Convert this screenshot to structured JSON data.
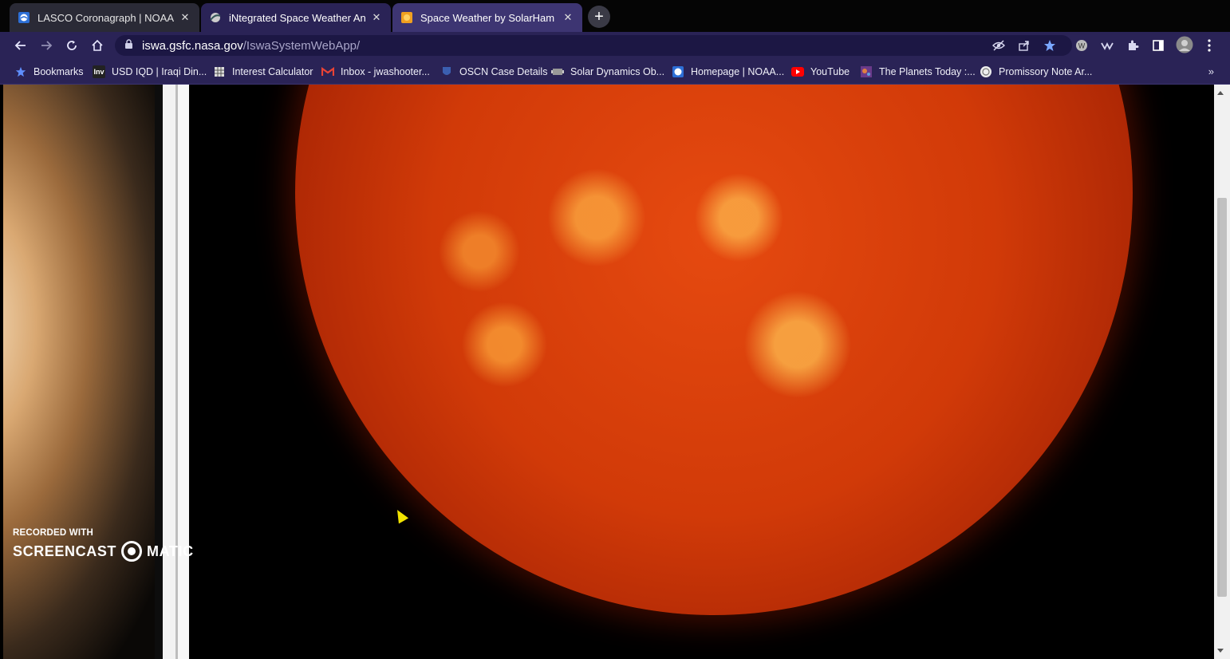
{
  "tabs": [
    {
      "title": "LASCO Coronagraph | NOAA / N",
      "favicon": "noaa-shield-icon",
      "active": false
    },
    {
      "title": "iNtegrated Space Weather Analy",
      "favicon": "nasa-swoosh-icon",
      "active": true
    },
    {
      "title": "Space Weather by SolarHam",
      "favicon": "solarham-icon",
      "active": false
    }
  ],
  "address_bar": {
    "host": "iswa.gsfc.nasa.gov",
    "path": "/IswaSystemWebApp/"
  },
  "bookmarks": [
    {
      "label": "Bookmarks",
      "icon": "star-icon"
    },
    {
      "label": "USD IQD | Iraqi Din...",
      "icon": "investing-icon"
    },
    {
      "label": "Interest Calculator",
      "icon": "calculator-icon"
    },
    {
      "label": "Inbox - jwashooter...",
      "icon": "gmail-icon"
    },
    {
      "label": "OSCN Case Details",
      "icon": "oscn-icon"
    },
    {
      "label": "Solar Dynamics Ob...",
      "icon": "sdo-icon"
    },
    {
      "label": "Homepage | NOAA...",
      "icon": "noaa-shield-icon"
    },
    {
      "label": "YouTube",
      "icon": "youtube-icon"
    },
    {
      "label": "The Planets Today :...",
      "icon": "planets-icon"
    },
    {
      "label": "Promissory Note Ar...",
      "icon": "promissory-icon"
    }
  ],
  "watermark": {
    "line1": "RECORDED WITH",
    "brand_left": "SCREENCAST",
    "brand_right": "MATIC"
  },
  "colors": {
    "toolbar": "#2a2356",
    "sun": "#e64a10"
  }
}
